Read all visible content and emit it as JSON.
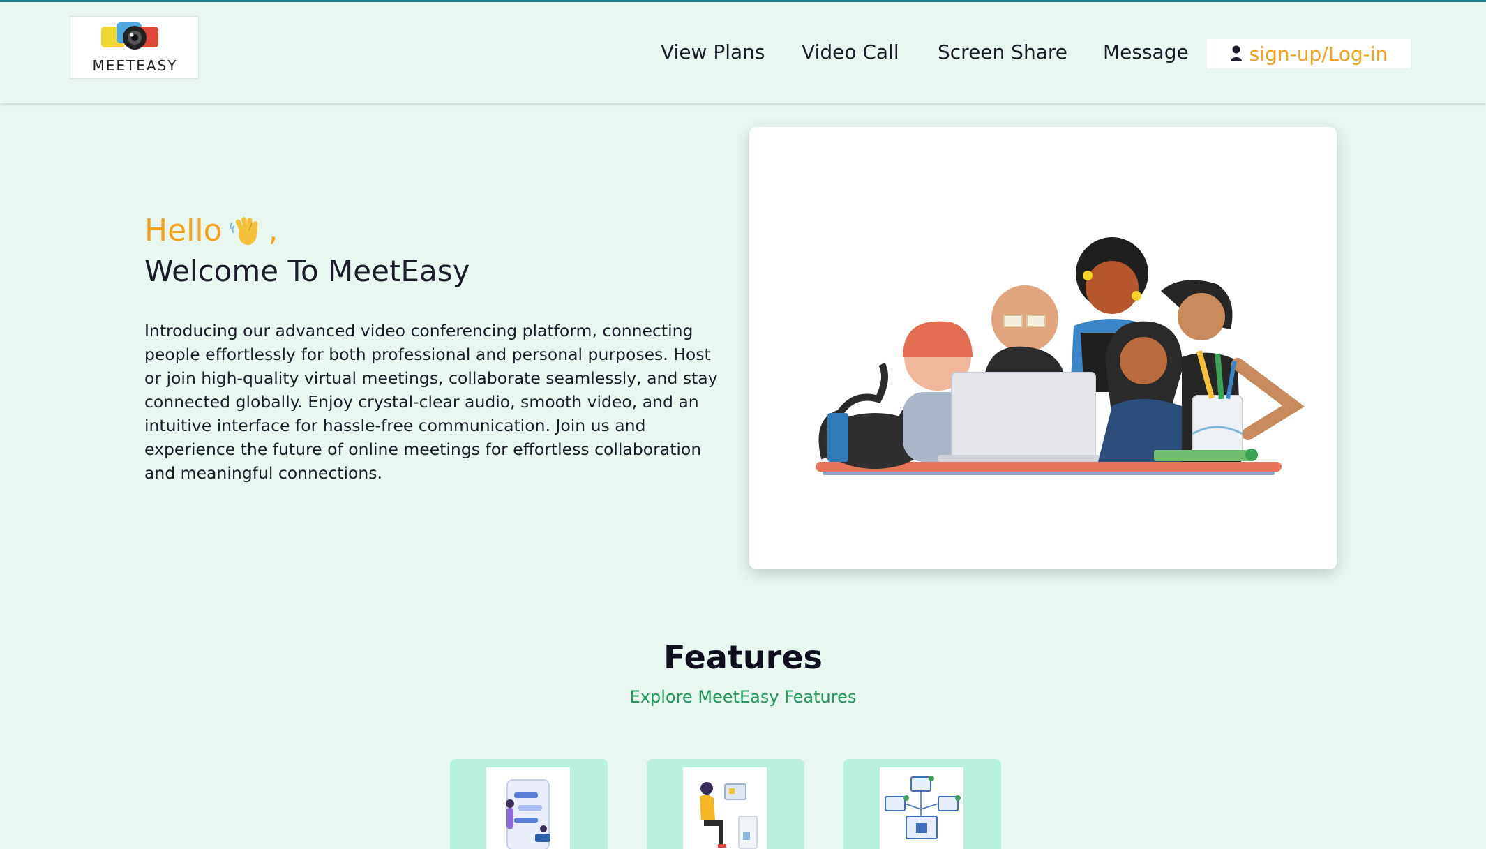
{
  "brand": {
    "logo_text": "MEETEASY"
  },
  "nav": {
    "items": [
      {
        "label": "View Plans"
      },
      {
        "label": "Video Call"
      },
      {
        "label": "Screen Share"
      },
      {
        "label": "Message"
      }
    ],
    "login_label": "sign-up/Log-in"
  },
  "hero": {
    "greeting": "Hello",
    "greeting_suffix": ",",
    "title": "Welcome To MeetEasy",
    "description": "Introducing our advanced video conferencing platform, connecting people effortlessly for both professional and personal purposes. Host or join high-quality virtual meetings, collaborate seamlessly, and stay connected globally. Enjoy crystal-clear audio, smooth video, and an intuitive interface for hassle-free communication. Join us and experience the future of online meetings for effortless collaboration and meaningful connections."
  },
  "features": {
    "title": "Features",
    "subtitle": "Explore MeetEasy Features"
  },
  "colors": {
    "background": "#e8f7ef",
    "accent": "#f5a21b",
    "subtitle": "#1f9a5a",
    "feature_card": "#b8f0dc"
  }
}
